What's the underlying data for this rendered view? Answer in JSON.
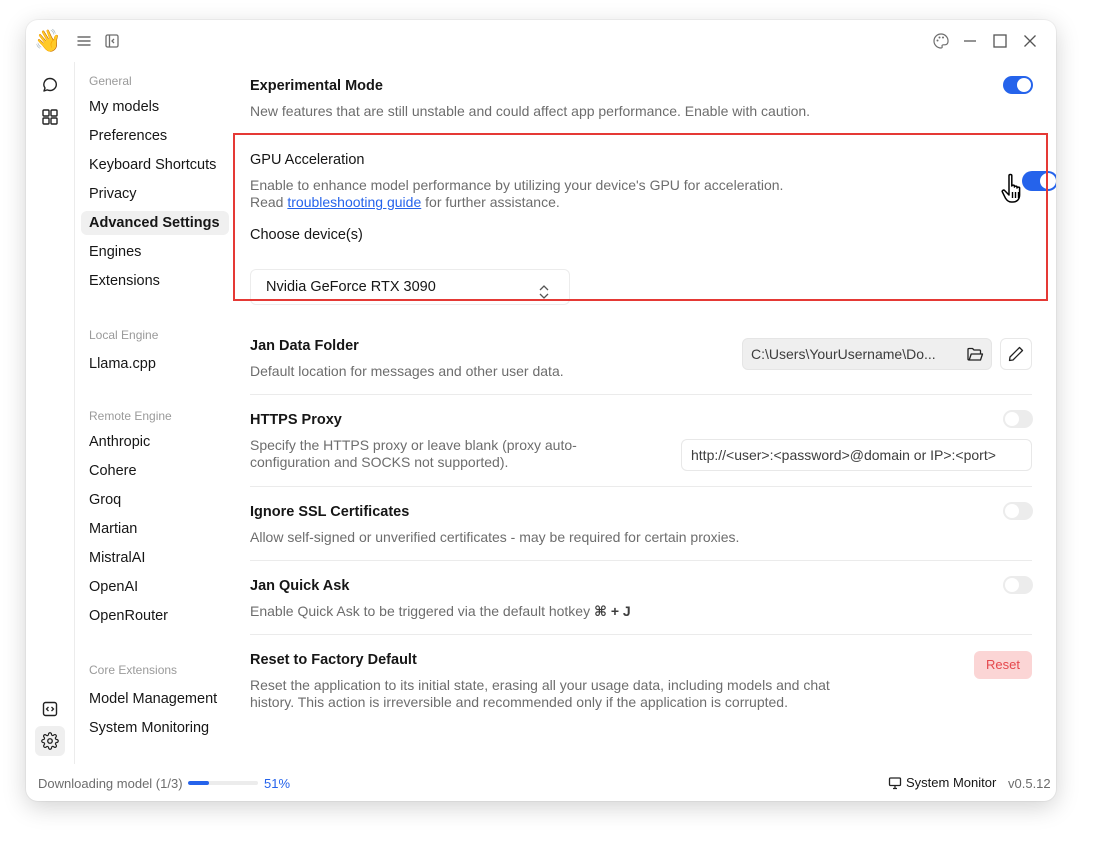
{
  "titlebar": {
    "app_icon": "waving-hand-icon",
    "app_icon_glyph": "👋",
    "left_icons": [
      "menu-icon",
      "collapse-sidebar-icon"
    ],
    "right_icons": [
      "palette-icon",
      "minimize-icon",
      "maximize-icon",
      "close-icon"
    ]
  },
  "rail": {
    "top_icons": [
      "chat-icon",
      "hub-grid-icon"
    ],
    "bottom_icons": [
      "code-icon",
      "settings-icon"
    ],
    "active": "settings-icon"
  },
  "settings_nav": {
    "groups": [
      {
        "label": "General",
        "items": [
          "My models",
          "Preferences",
          "Keyboard Shortcuts",
          "Privacy",
          "Advanced Settings",
          "Engines",
          "Extensions"
        ]
      },
      {
        "label": "Local Engine",
        "items": [
          "Llama.cpp"
        ]
      },
      {
        "label": "Remote Engine",
        "items": [
          "Anthropic",
          "Cohere",
          "Groq",
          "Martian",
          "MistralAI",
          "OpenAI",
          "OpenRouter"
        ]
      },
      {
        "label": "Core Extensions",
        "items": [
          "Model Management",
          "System Monitoring"
        ]
      }
    ],
    "active_item": "Advanced Settings"
  },
  "settings": {
    "experimental": {
      "title": "Experimental Mode",
      "description": "New features that are still unstable and could affect app performance. Enable with caution.",
      "enabled": true
    },
    "gpu": {
      "title": "GPU Acceleration",
      "description_line1": "Enable to enhance model performance by utilizing your device's GPU for acceleration.",
      "description_prefix": "Read ",
      "link_text": "troubleshooting guide",
      "description_suffix": " for further assistance.",
      "enabled": true,
      "choose_label": "Choose device(s)",
      "selected_device": "Nvidia GeForce RTX 3090"
    },
    "data_folder": {
      "title": "Jan Data Folder",
      "description": "Default location for messages and other user data.",
      "path": "C:\\Users\\YourUsername\\Do..."
    },
    "https_proxy": {
      "title": "HTTPS Proxy",
      "description_line1": "Specify the HTTPS proxy or leave blank (proxy auto-",
      "description_line2": "configuration and SOCKS not supported).",
      "enabled": false,
      "placeholder": "http://<user>:<password>@domain or IP>:<port>"
    },
    "ignore_ssl": {
      "title": "Ignore SSL Certificates",
      "description": "Allow self-signed or unverified certificates - may be required for certain proxies.",
      "enabled": false
    },
    "quick_ask": {
      "title": "Jan Quick Ask",
      "description": "Enable Quick Ask to be triggered via the default hotkey ",
      "hotkey": "⌘ + J",
      "enabled": false
    },
    "factory_reset": {
      "title": "Reset to Factory Default",
      "description_line1": "Reset the application to its initial state, erasing all your usage data, including models and chat",
      "description_line2": "history. This action is irreversible and recommended only if the application is corrupted.",
      "button_label": "Reset"
    }
  },
  "statusbar": {
    "download_text": "Downloading model (1/3)",
    "progress_fraction": 0.3,
    "progress_text": "51%",
    "system_monitor_label": "System Monitor",
    "version": "v0.5.12"
  },
  "colors": {
    "accent": "#2563eb",
    "highlight_border": "#e53935",
    "danger_bg": "#fbd5d5",
    "danger_text": "#e5484d"
  }
}
